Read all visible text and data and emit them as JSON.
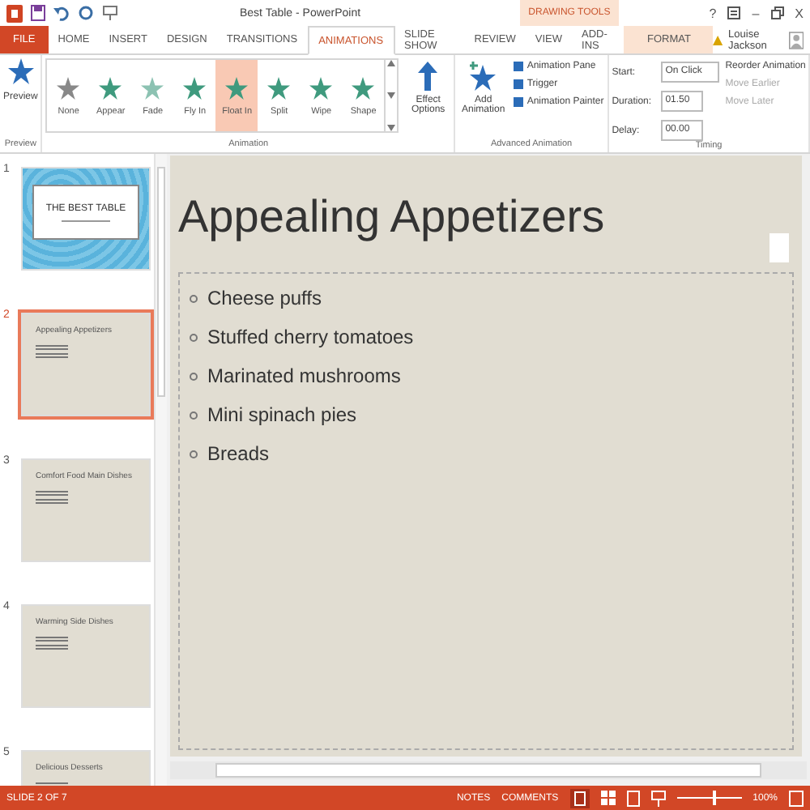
{
  "window": {
    "title": "Best Table - PowerPoint",
    "controls": [
      "?",
      "–",
      "X"
    ]
  },
  "tabs": [
    {
      "label": "FILE",
      "kind": "file",
      "selected": false
    },
    {
      "label": "HOME",
      "kind": "tab",
      "selected": false
    },
    {
      "label": "INSERT",
      "kind": "tab",
      "selected": false
    },
    {
      "label": "DESIGN",
      "kind": "tab",
      "selected": false
    },
    {
      "label": "TRANSITIONS",
      "kind": "tab",
      "selected": false
    },
    {
      "label": "ANIMATIONS",
      "kind": "tab",
      "selected": true
    },
    {
      "label": "SLIDE SHOW",
      "kind": "tab",
      "selected": false
    },
    {
      "label": "REVIEW",
      "kind": "tab",
      "selected": false
    },
    {
      "label": "VIEW",
      "kind": "tab",
      "selected": false
    },
    {
      "label": "ADD-INS",
      "kind": "tab",
      "selected": false
    },
    {
      "label": "FORMAT",
      "kind": "contextual",
      "selected": false
    }
  ],
  "contextual_group": "DRAWING TOOLS",
  "user": "Louise Jackson",
  "ribbon": {
    "preview": {
      "button": "Preview",
      "group": "Preview"
    },
    "animations": [
      {
        "label": "None",
        "selected": false
      },
      {
        "label": "Appear",
        "selected": false
      },
      {
        "label": "Fade",
        "selected": false
      },
      {
        "label": "Fly In",
        "selected": false
      },
      {
        "label": "Float In",
        "selected": true
      },
      {
        "label": "Split",
        "selected": false
      },
      {
        "label": "Wipe",
        "selected": false
      },
      {
        "label": "Shape",
        "selected": false
      }
    ],
    "effect_options": "Effect Options",
    "animation_group": "Animation",
    "add_animation": "Add Animation",
    "advanced": [
      "Animation Pane",
      "Trigger",
      "Animation Painter"
    ],
    "advanced_group": "Advanced Animation",
    "timing": {
      "start_label": "Start:",
      "start": "On Click",
      "duration_label": "Duration:",
      "duration": "01.50",
      "delay_label": "Delay:",
      "delay": "00.00",
      "reorder": "Reorder Animation",
      "move": [
        {
          "label": "Move Earlier",
          "disabled": true
        },
        {
          "label": "Move Later",
          "disabled": true
        }
      ],
      "group": "Timing"
    }
  },
  "slides": [
    {
      "number": "1",
      "kind": "title",
      "title": "THE BEST TABLE",
      "selected": false
    },
    {
      "number": "2",
      "kind": "content",
      "title": "Appealing Appetizers",
      "selected": true
    },
    {
      "number": "3",
      "kind": "content",
      "title": "Comfort Food Main Dishes",
      "selected": false
    },
    {
      "number": "4",
      "kind": "content",
      "title": "Warming Side Dishes",
      "selected": false
    },
    {
      "number": "5",
      "kind": "content",
      "title": "Delicious Desserts",
      "selected": false
    }
  ],
  "slide": {
    "title": "Appealing Appetizers",
    "bullets": [
      "Cheese puffs",
      "Stuffed cherry tomatoes",
      "Marinated mushrooms",
      "Mini spinach pies",
      "Breads"
    ]
  },
  "status_bar": {
    "slide": "SLIDE 2 OF 7",
    "notes": "NOTES",
    "comments": "COMMENTS",
    "level": 0.55,
    "zoom": "100%"
  }
}
